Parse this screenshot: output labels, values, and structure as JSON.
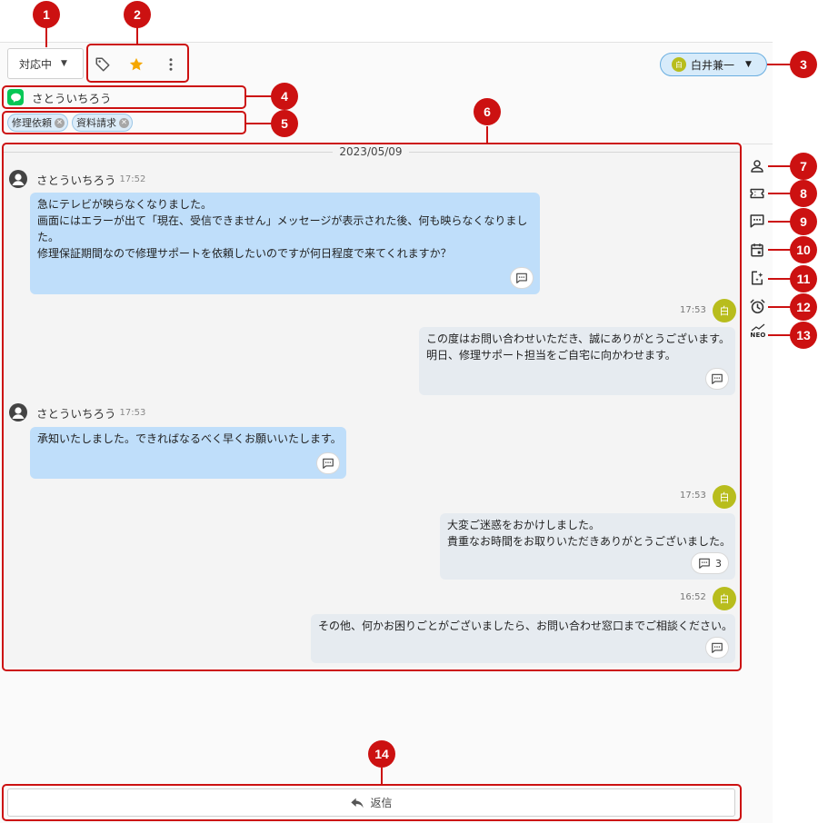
{
  "toolbar": {
    "status_label": "対応中",
    "assignee_initial": "白",
    "assignee_name": "白井兼一"
  },
  "customer": {
    "name": "さとういちろう"
  },
  "tags": [
    {
      "label": "修理依頼"
    },
    {
      "label": "資料請求"
    }
  ],
  "conversation": {
    "date": "2023/05/09",
    "messages": [
      {
        "direction": "in",
        "sender": "さとういちろう",
        "time": "17:52",
        "lines": [
          "急にテレビが映らなくなりました。",
          "画面にはエラーが出て「現在、受信できません」メッセージが表示された後、何も映らなくなりまし",
          "た。",
          "修理保証期間なので修理サポートを依頼したいのですが何日程度で来てくれますか？"
        ]
      },
      {
        "direction": "out",
        "sender_initial": "白",
        "time": "17:53",
        "lines": [
          "この度はお問い合わせいただき、誠にありがとうございます。",
          "明日、修理サポート担当をご自宅に向かわせます。"
        ]
      },
      {
        "direction": "in",
        "sender": "さとういちろう",
        "time": "17:53",
        "lines": [
          "承知いたしました。できればなるべく早くお願いいたします。"
        ]
      },
      {
        "direction": "out",
        "sender_initial": "白",
        "time": "17:53",
        "lines": [
          "大変ご迷惑をおかけしました。",
          "貴重なお時間をお取りいただきありがとうございました。"
        ],
        "reply_count": "3"
      },
      {
        "direction": "out",
        "sender_initial": "白",
        "time": "16:52",
        "lines": [
          "その他、何かお困りごとがございましたら、お問い合わせ窓口までご相談ください。"
        ]
      }
    ]
  },
  "sidebar": {
    "icons": [
      "person-icon",
      "ticket-icon",
      "comment-icon",
      "calendar-icon",
      "ai-sparkle-icon",
      "alarm-icon",
      "neo-icon"
    ],
    "neo_label": "NEO"
  },
  "reply_bar": {
    "label": "返信"
  },
  "callouts": [
    "1",
    "2",
    "3",
    "4",
    "5",
    "6",
    "7",
    "8",
    "9",
    "10",
    "11",
    "12",
    "13",
    "14"
  ],
  "colors": {
    "callout": "#cc1111",
    "incoming_bubble": "#bfdefa",
    "outgoing_bubble": "#e6ebf0",
    "agent_avatar": "#b8bd1d",
    "line_green": "#06c755",
    "star": "#f5a700"
  }
}
